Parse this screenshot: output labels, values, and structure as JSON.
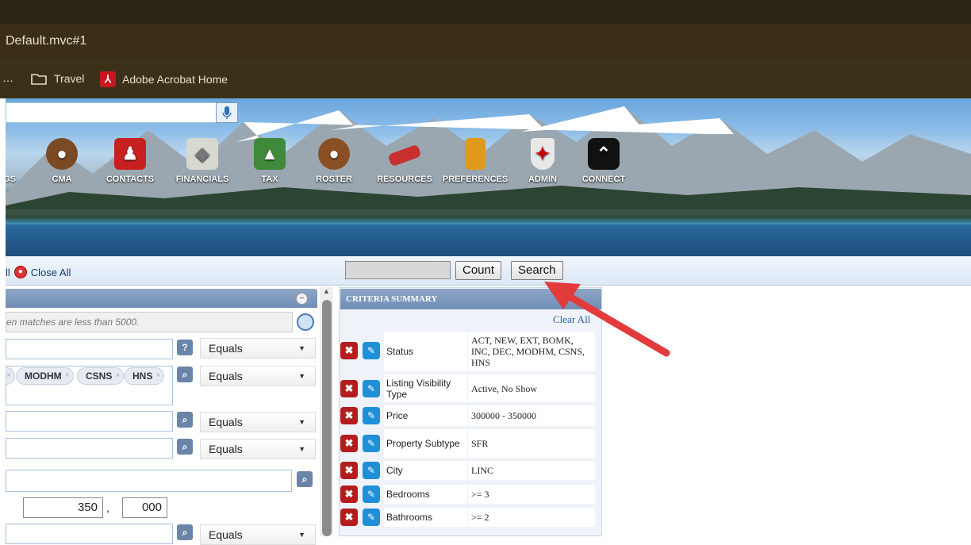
{
  "browser": {
    "url": "Default.mvc#1",
    "bookmarks": [
      {
        "label": "…",
        "icon": "overflow-icon"
      },
      {
        "label": "Travel",
        "icon": "folder-icon"
      },
      {
        "label": "Adobe Acrobat Home",
        "icon": "pdf-icon"
      }
    ]
  },
  "nav": {
    "items": [
      "GS",
      "CMA",
      "CONTACTS",
      "FINANCIALS",
      "TAX",
      "ROSTER",
      "RESOURCES",
      "PREFERENCES",
      "ADMIN",
      "CONNECT"
    ]
  },
  "toolbar": {
    "close_prefix": "ll",
    "close_all": "Close All",
    "count": "Count",
    "search": "Search"
  },
  "left": {
    "note": "en matches are less than 5000.",
    "operators": [
      "Equals",
      "Equals",
      "Equals",
      "Equals",
      "Equals"
    ],
    "tags": [
      "MODHM",
      "CSNS",
      "HNS"
    ],
    "price_main": "350",
    "price_sep": ",",
    "price_thousands": "000"
  },
  "criteria": {
    "title": "CRITERIA SUMMARY",
    "clear_all": "Clear All",
    "rows": [
      {
        "label": "Status",
        "value": "ACT, NEW, EXT, BOMK, INC, DEC, MODHM, CSNS, HNS"
      },
      {
        "label": "Listing Visibility Type",
        "value": "Active, No Show"
      },
      {
        "label": "Price",
        "value": "300000 - 350000"
      },
      {
        "label": "Property Subtype",
        "value": "SFR"
      },
      {
        "label": "City",
        "value": "LINC"
      },
      {
        "label": "Bedrooms",
        "value": ">= 3"
      },
      {
        "label": "Bathrooms",
        "value": ">= 2"
      }
    ]
  },
  "colors": {
    "annotation_arrow": "#e23b3b",
    "header_blue": "#6f8db5",
    "delete_red": "#b31d1d",
    "edit_blue": "#1f8fd8"
  }
}
